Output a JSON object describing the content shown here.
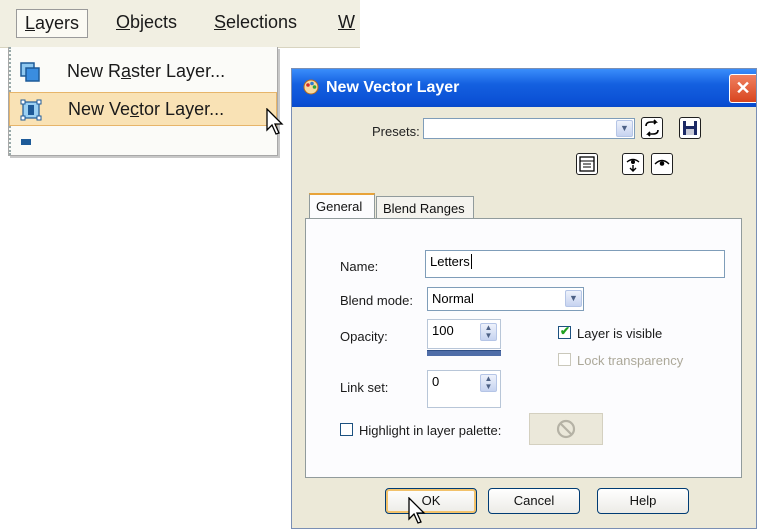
{
  "menubar": {
    "items": [
      {
        "pre": "",
        "u": "L",
        "post": "ayers"
      },
      {
        "pre": "",
        "u": "O",
        "post": "bjects"
      },
      {
        "pre": "",
        "u": "S",
        "post": "elections"
      },
      {
        "pre": "",
        "u": "W",
        "post": ""
      }
    ]
  },
  "layers_menu": {
    "items": [
      {
        "pre": "New R",
        "u": "a",
        "post": "ster Layer..."
      },
      {
        "pre": "New Ve",
        "u": "c",
        "post": "tor Layer..."
      }
    ]
  },
  "dialog": {
    "title": "New Vector Layer",
    "close_glyph": "✕",
    "presets_label": "Presets:",
    "presets_value": "",
    "tabs": [
      "General",
      "Blend Ranges"
    ],
    "name_label": "Name:",
    "name_value": "Letters",
    "blend_mode_label": "Blend mode:",
    "blend_mode_value": "Normal",
    "opacity_label": "Opacity:",
    "opacity_value": "100",
    "opacity_fraction": 1.0,
    "link_set_label": "Link set:",
    "link_set_value": "0",
    "layer_visible_label": "Layer is visible",
    "layer_visible_checked": true,
    "lock_transparency_label": "Lock transparency",
    "lock_transparency_checked": false,
    "highlight_label": "Highlight in layer palette:",
    "highlight_checked": false,
    "buttons": {
      "ok": "OK",
      "cancel": "Cancel",
      "help": "Help"
    }
  },
  "colors": {
    "titlebar": "#0a4fd4",
    "menu_highlight": "#f9e2b5",
    "dialog_bg": "#ece9d8",
    "tab_accent": "#e8a33a"
  }
}
